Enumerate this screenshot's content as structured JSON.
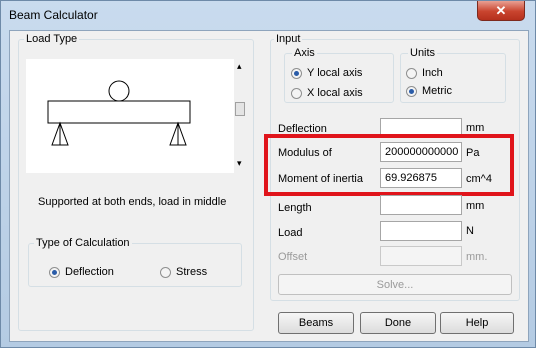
{
  "window": {
    "title": "Beam Calculator",
    "close_glyph": "✕",
    "close_icon": "close-icon"
  },
  "load_type": {
    "legend": "Load Type",
    "description": "Supported at both ends, load in middle",
    "scroll_up_glyph": "▴",
    "scroll_down_glyph": "▾"
  },
  "calc_type": {
    "legend": "Type of Calculation",
    "options": [
      {
        "label": "Deflection",
        "checked": true
      },
      {
        "label": "Stress",
        "checked": false
      }
    ]
  },
  "input": {
    "legend": "Input",
    "axis": {
      "legend": "Axis",
      "options": [
        {
          "label": "Y local axis",
          "checked": true
        },
        {
          "label": "X local axis",
          "checked": false
        }
      ]
    },
    "units": {
      "legend": "Units",
      "options": [
        {
          "label": "Inch",
          "checked": false
        },
        {
          "label": "Metric",
          "checked": true
        }
      ]
    },
    "fields": {
      "deflection": {
        "label": "Deflection",
        "value": "",
        "unit": "mm"
      },
      "modulus": {
        "label": "Modulus of",
        "value": "200000000000",
        "unit": "Pa"
      },
      "inertia": {
        "label": "Moment of inertia",
        "value": "69.926875",
        "unit": "cm^4"
      },
      "length": {
        "label": "Length",
        "value": "",
        "unit": "mm"
      },
      "load": {
        "label": "Load",
        "value": "",
        "unit": "N"
      },
      "offset": {
        "label": "Offset",
        "value": "",
        "unit": "mm."
      }
    },
    "solve_label": "Solve..."
  },
  "footer": {
    "beams_label": "Beams",
    "done_label": "Done",
    "help_label": "Help"
  },
  "colors": {
    "highlight": "#e0141b",
    "radio_dot": "#2a5ca8",
    "close_button": "#c9442e"
  }
}
